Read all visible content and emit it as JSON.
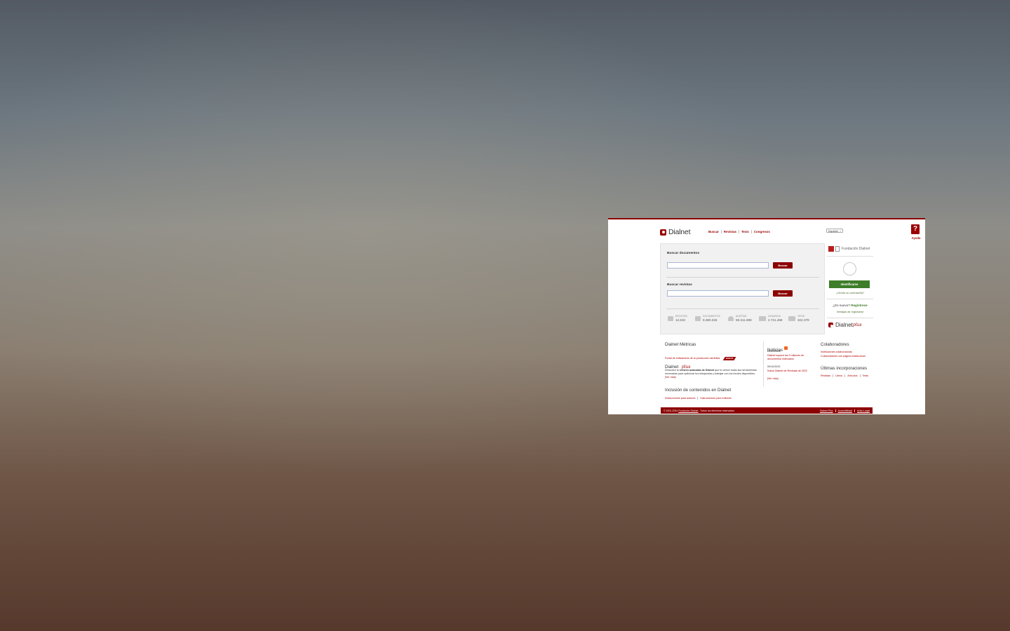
{
  "site": {
    "logo_text": "Dialnet",
    "nav": [
      "Buscar",
      "Revistas",
      "Tesis",
      "Congresos"
    ],
    "language": "Español",
    "help_label": "Ayuda"
  },
  "search": {
    "documents_label": "Buscar documentos",
    "documents_button": "Buscar",
    "journals_label": "Buscar revistas",
    "journals_button": "Buscar"
  },
  "stats": [
    {
      "label": "REVISTAS",
      "value": "12.632",
      "icon": "journal-icon"
    },
    {
      "label": "DOCUMENTOS",
      "value": "9.380.326",
      "icon": "document-icon"
    },
    {
      "label": "ALERTAS",
      "value": "58.311.898",
      "icon": "bell-icon"
    },
    {
      "label": "USUARIOS",
      "value": "2.721.468",
      "icon": "users-icon"
    },
    {
      "label": "TESIS",
      "value": "322.379",
      "icon": "graduation-cap-icon"
    }
  ],
  "sidebar": {
    "foundation": "Fundación Dialnet",
    "login_button": "Identificarse",
    "forgot_password": "¿Olvidó su contraseña?",
    "new_text": "¿Es nuevo?",
    "register": "Regístrese",
    "register_benefits": "Ventajas de registrarse",
    "plus_brand": "Dialnet",
    "plus_word": "plus"
  },
  "metrics": {
    "title": "Dialnet Métricas",
    "link": "Portal de indicadores de la producción científica",
    "badge": "NUEVO"
  },
  "plus_section": {
    "title": "Dialnet",
    "plus_word": "plus",
    "text_pre": "Descubre la ",
    "text_bold": "versión avanzada de Dialnet",
    "text_post": " que te ofrece todas las herramientas necesarias para optimizar tus búsquedas y trabajar con los fondos disponibles.",
    "more": "[Ver más]"
  },
  "inclusion": {
    "title": "Inclusión de contenidos en Dialnet",
    "links": [
      "Instrucciones para autores",
      "Instrucciones para editores"
    ]
  },
  "news": {
    "title": "Noticias",
    "items": [
      {
        "date": "09/02/2024",
        "text": "Dialnet supera los 9 millones de documentos indexados"
      },
      {
        "date": "09/10/2023",
        "text": "Índice Dialnet de Revistas de 2022"
      }
    ],
    "more": "[Ver más]"
  },
  "collaborators": {
    "title": "Colaboradores",
    "links": [
      "Instituciones colaboradoras",
      "Colaboradores con página institucional"
    ]
  },
  "latest": {
    "title": "Últimas incorporaciones",
    "links": [
      "Revistas",
      "Libros",
      "Artículos",
      "Tesis"
    ]
  },
  "footer": {
    "copyright": "© 2001-2024 ",
    "foundation_link": "Fundación Dialnet",
    "rights": " - Todos los derechos reservados",
    "links": [
      "Dialnet Plus",
      "Accesibilidad",
      "Aviso Legal"
    ]
  },
  "colors": {
    "brand": "#8b0000",
    "login": "#3e7d2a"
  }
}
